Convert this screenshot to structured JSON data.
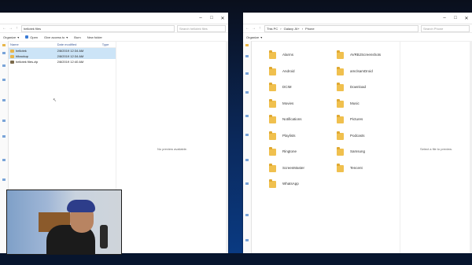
{
  "left": {
    "title": "hellotek files",
    "path": "hellotek files",
    "search_placeholder": "Search hellotek files",
    "commands": [
      "Organize",
      "Open",
      "Give access to",
      "Burn",
      "New folder"
    ],
    "columns": [
      "Name",
      "Date modified",
      "Type"
    ],
    "files": [
      {
        "name": "hellotek",
        "date": "2/8/2019 12:34 AM",
        "type": "",
        "selected": true,
        "kind": "folder"
      },
      {
        "name": "hlbackup",
        "date": "2/8/2019 12:34 AM",
        "type": "",
        "selected": true,
        "kind": "folder"
      },
      {
        "name": "hellotek files.zip",
        "date": "2/8/2019 12:40 AM",
        "type": "",
        "selected": false,
        "kind": "zip"
      }
    ],
    "preview_text": "No preview available."
  },
  "right": {
    "breadcrumb": [
      "This PC",
      "Galaxy J6+",
      "Phone"
    ],
    "search_placeholder": "Search Phone",
    "commands": [
      "Organize"
    ],
    "folders_col1": [
      "Alarms",
      "Android",
      "DCIM",
      "Movies",
      "Notifications",
      "Playlists",
      "Ringtone",
      "ScreenMaster",
      "WhatsApp"
    ],
    "folders_col2": [
      "AVRBJScreenshots",
      "amclsamDroid",
      "Download",
      "Music",
      "Pictures",
      "Podcasts",
      "Samsung",
      "Tencent"
    ],
    "preview_text": "Select a file to preview."
  },
  "colors": {
    "selection": "#cce4f7",
    "folder": "#f0c04e",
    "link": "#3b5998"
  }
}
